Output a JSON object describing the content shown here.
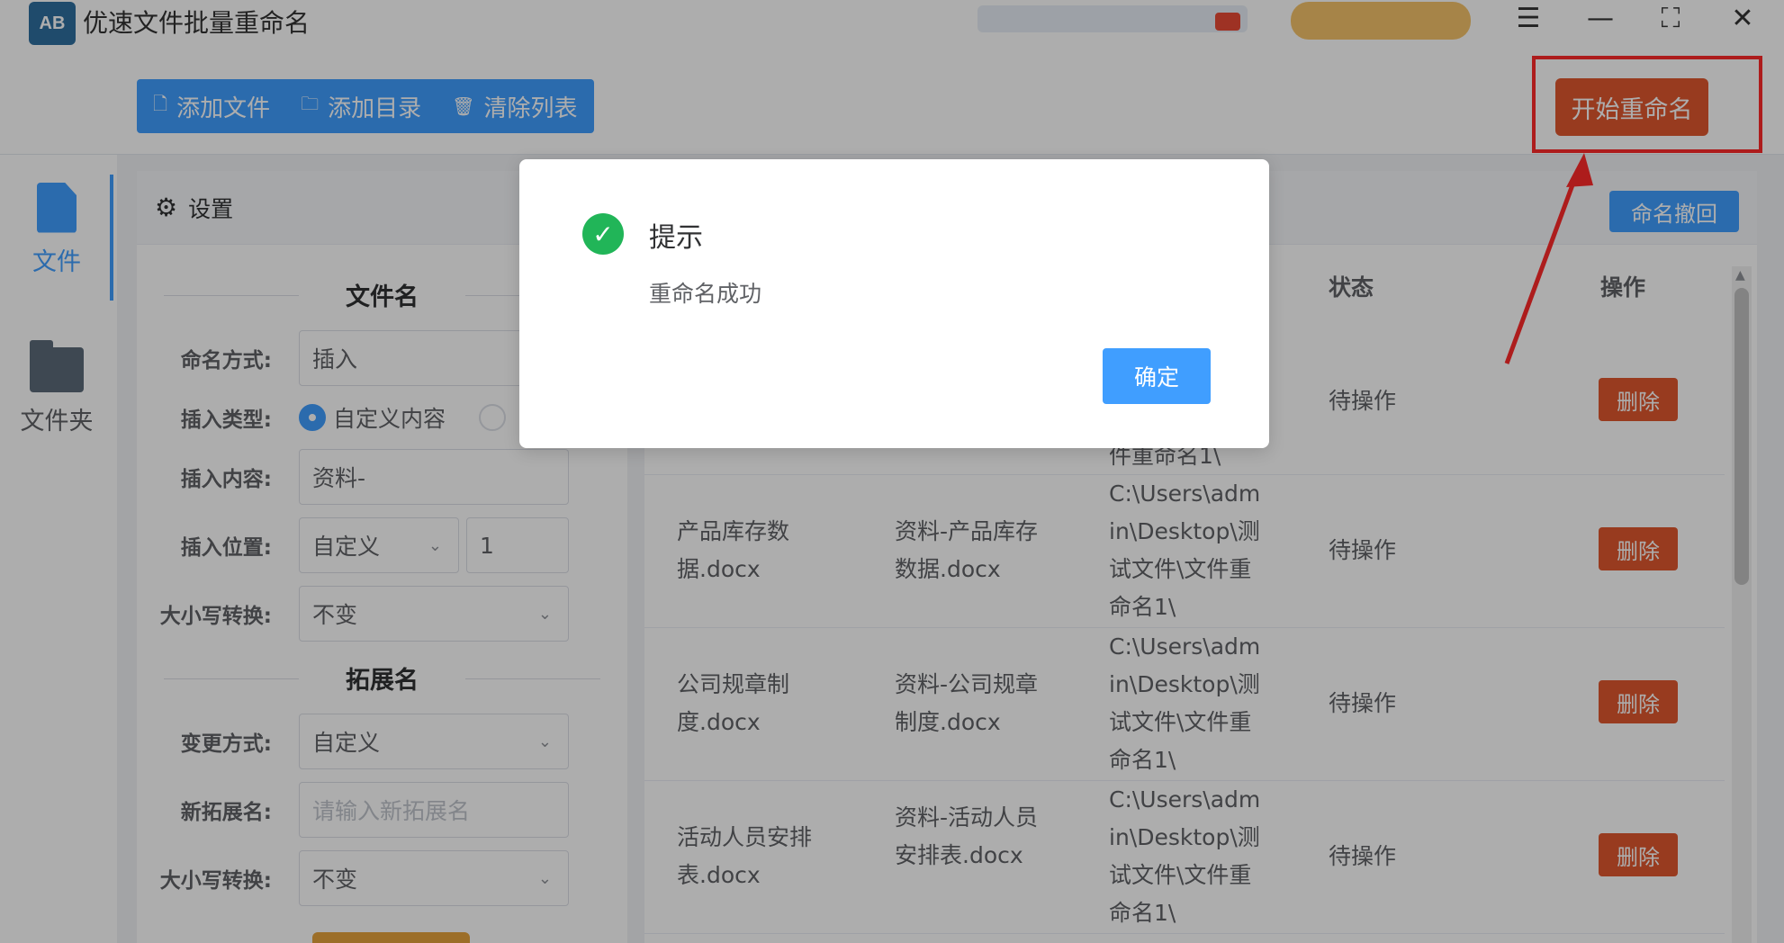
{
  "app": {
    "title": "优速文件批量重命名",
    "logo_text": "AB"
  },
  "window_controls": {
    "menu": "☰",
    "minimize": "—",
    "maximize": "⛶",
    "close": "✕"
  },
  "toolbar": {
    "add_file": "添加文件",
    "add_dir": "添加目录",
    "clear_list": "清除列表",
    "start_rename": "开始重命名"
  },
  "sidenav": {
    "file": "文件",
    "folder": "文件夹"
  },
  "settings": {
    "header": "设置",
    "filename_section": "文件名",
    "naming_mode_label": "命名方式:",
    "naming_mode_value": "插入",
    "insert_type_label": "插入类型:",
    "insert_type_option1": "自定义内容",
    "insert_content_label": "插入内容:",
    "insert_content_value": "资料-",
    "insert_pos_label": "插入位置:",
    "insert_pos_value": "自定义",
    "insert_pos_number": "1",
    "case_label": "大小写转换:",
    "case_value": "不变",
    "ext_section": "拓展名",
    "change_mode_label": "变更方式:",
    "change_mode_value": "自定义",
    "new_ext_label": "新拓展名:",
    "new_ext_placeholder": "请输入新拓展名",
    "ext_case_label": "大小写转换:",
    "ext_case_value": "不变"
  },
  "table": {
    "undo": "命名撤回",
    "headers": {
      "status": "状态",
      "action": "操作"
    },
    "rows": [
      {
        "orig": "",
        "new": "",
        "path": "件重命名1\\",
        "status": "待操作",
        "action": "删除"
      },
      {
        "orig": "产品库存数据.docx",
        "new": "资料-产品库存数据.docx",
        "path": "C:\\Users\\admin\\Desktop\\测试文件\\文件重命名1\\",
        "status": "待操作",
        "action": "删除"
      },
      {
        "orig": "公司规章制度.docx",
        "new": "资料-公司规章制度.docx",
        "path": "C:\\Users\\admin\\Desktop\\测试文件\\文件重命名1\\",
        "status": "待操作",
        "action": "删除"
      },
      {
        "orig": "活动人员安排表.docx",
        "new": "资料-活动人员安排表.docx",
        "path": "C:\\Users\\admin\\Desktop\\测试文件\\文件重命名1\\",
        "status": "待操作",
        "action": "删除"
      }
    ]
  },
  "dialog": {
    "title": "提示",
    "message": "重命名成功",
    "ok": "确定"
  },
  "colors": {
    "primary": "#409eff",
    "danger": "#e0582f",
    "success": "#21b558",
    "highlight": "#ff2a2a"
  }
}
